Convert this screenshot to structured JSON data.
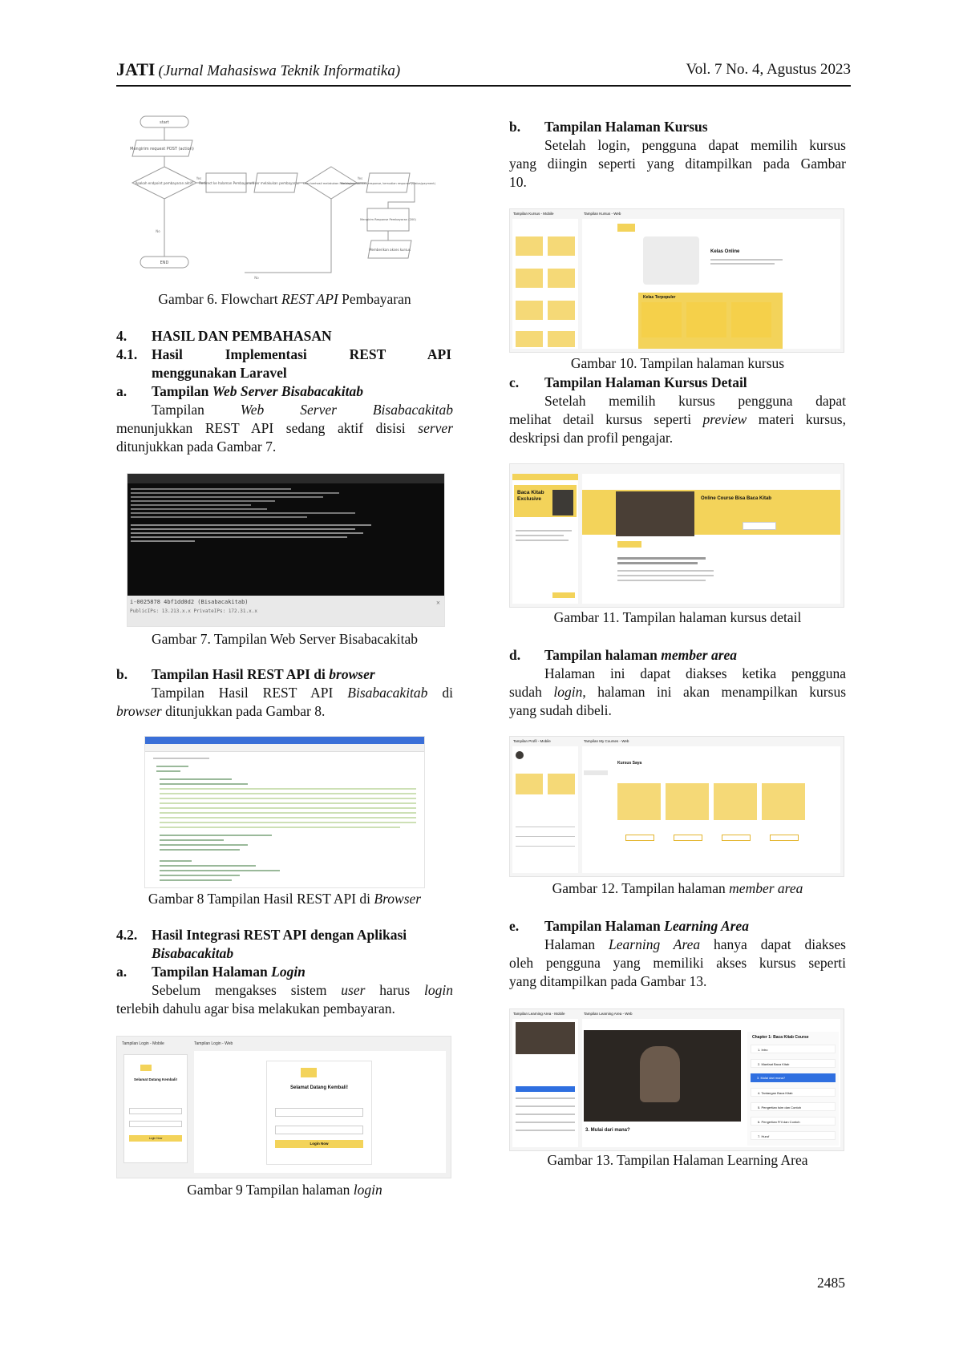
{
  "header": {
    "journal": "JATI",
    "journal_full": "(Jurnal Mahasiswa Teknik Informatika)",
    "volume": "Vol. 7 No. 4, Agustus 2023"
  },
  "left": {
    "fig6_caption_pre": "Gambar 6. Flowchart ",
    "fig6_caption_em": "REST API",
    "fig6_caption_post": " Pembayaran",
    "flowchart": {
      "start": "start",
      "n1": "Mengirim request POST (action)",
      "n2": "Apakah endpoint pembayaran aktif?",
      "n3": "Redirect ke halaman Pembayaran",
      "n4": "User melakukan pembayaran",
      "n5": "User berhasil melakukan Pembayaran?",
      "n6": "Melakukan validasi response, kemudian response (status/payment)",
      "n7": "Mengirim Response Pembayaran (200)",
      "n8": "Memberikan akses kursus",
      "yes": "Yes",
      "no": "No",
      "end": "END"
    },
    "sec4_num": "4.",
    "sec4_title": "HASIL DAN PEMBAHASAN",
    "sec41_num": "4.1.",
    "sec41_title_l1": "Hasil Implementasi REST API",
    "sec41_title_l2": "menggunakan Laravel",
    "a_label": "a.",
    "a_title_pre": "Tampilan ",
    "a_title_em": "Web Server Bisabacakitab",
    "a_p_l1_pre": "Tampilan ",
    "a_p_l1_em": "Web Server Bisabacakitab",
    "a_p_l2_pre": "menunjukkan REST API sedang aktif disisi ",
    "a_p_l2_em": "server",
    "a_p_l3": "ditunjukkan pada Gambar 7.",
    "terminal_footer_l1": "i-0025878 4bf1dd0d2 (Bisabacakitab)",
    "terminal_footer_l2": "PublicIPs: 13.213.x.x  PrivateIPs: 172.31.x.x",
    "fig7_caption": "Gambar 7. Tampilan Web Server Bisabacakitab",
    "b_label": "b.",
    "b_title_pre": "Tampilan Hasil REST API di ",
    "b_title_em": "browser",
    "b_p_l1_pre": "Tampilan Hasil REST API ",
    "b_p_l1_em": "Bisabacakitab",
    "b_p_l1_post": " di",
    "b_p_l2_em": "browser",
    "b_p_l2_post": " ditunjukkan pada Gambar 8.",
    "fig8_caption_pre": "Gambar 8 Tampilan Hasil REST API di ",
    "fig8_caption_em": "Browser",
    "sec42_num": "4.2.",
    "sec42_title_l1": "Hasil Integrasi REST API dengan Aplikasi",
    "sec42_title_l2": "Bisabacakitab",
    "a2_label": "a.",
    "a2_title_pre": "Tampilan Halaman ",
    "a2_title_em": "Login",
    "a2_p_l1_pre": "Sebelum mengakses sistem ",
    "a2_p_l1_em": "user",
    "a2_p_l1_mid": " harus ",
    "a2_p_l1_em2": "login",
    "a2_p_l2": "terlebih dahulu agar bisa melakukan pembayaran.",
    "login_mobile_label": "Tampilan Login - Mobile",
    "login_web_label": "Tampilan Login - Web",
    "login_welcome": "Selamat Datang Kembali!",
    "login_button": "Login Now",
    "fig9_caption_pre": "Gambar 9 Tampilan halaman ",
    "fig9_caption_em": "login"
  },
  "right": {
    "b_label": "b.",
    "b_title": "Tampilan Halaman Kursus",
    "b_p_l1": "Setelah login, pengguna dapat memilih kursus",
    "b_p_l2": "yang diingin seperti yang ditampilkan pada Gambar",
    "b_p_l3": "10.",
    "kursus_mobile_label": "Tampilan Kursus - Mobile",
    "kursus_web_label": "Tampilan Kursus - Web",
    "kelas_online": "Kelas Online",
    "kelas_terpopuler": "Kelas Terpopuler",
    "fig10_caption": "Gambar 10. Tampilan halaman kursus",
    "c_label": "c.",
    "c_title": "Tampilan Halaman Kursus Detail",
    "c_p_l1": "Setelah memilih kursus pengguna dapat",
    "c_p_l2_pre": "melihat detail kursus seperti ",
    "c_p_l2_em": "preview",
    "c_p_l2_post": " materi kursus,",
    "c_p_l3": "deskripsi dan profil pengajar.",
    "detail_card_title": "Baca Kitab Exclusive",
    "detail_course_title": "Online Course Bisa Baca Kitab",
    "fig11_caption": "Gambar 11. Tampilan halaman kursus detail",
    "d_label": "d.",
    "d_title_pre": "Tampilan halaman ",
    "d_title_em": "member area",
    "d_p_l1": "Halaman ini dapat diakses ketika pengguna",
    "d_p_l2_pre": "sudah ",
    "d_p_l2_em": "login",
    "d_p_l2_post": ", halaman ini akan menampilkan kursus",
    "d_p_l3": "yang sudah dibeli.",
    "member_mobile_label": "Tampilan Profil - Mobile",
    "member_web_label": "Tampilan My Courses - Web",
    "kursus_saya": "Kursus Saya",
    "fig12_caption_pre": "Gambar 12. Tampilan halaman ",
    "fig12_caption_em": "member area",
    "e_label": "e.",
    "e_title_pre": "Tampilan Halaman ",
    "e_title_em": "Learning Area",
    "e_p_l1_pre": "Halaman ",
    "e_p_l1_em": "Learning Area",
    "e_p_l1_post": " hanya dapat diakses",
    "e_p_l2": "oleh pengguna yang memiliki akses kursus seperti",
    "e_p_l3": "yang ditampilkan pada Gambar 13.",
    "learning_mobile_label": "Tampilan Learning Area - Mobile",
    "learning_web_label": "Tampilan Learning Area - Web",
    "chapter_title": "Chapter 1: Baca Kitab Course",
    "video_subtitle": "3. Mulai dari mana?",
    "lessons": [
      "1. Intro",
      "2. Manfaat Baca Kitab",
      "3. Mulai dari mana?",
      "4. Tantangan Baca Kitab",
      "5. Pengertian Isim dan Contoh",
      "6. Pengertian Fi'il dan Contoh",
      "7. Huruf"
    ],
    "fig13_caption": "Gambar 13. Tampilan Halaman Learning Area"
  },
  "page_number": "2485",
  "colors": {
    "accent_yellow": "#f3d35a",
    "terminal_bg": "#0c0c0c",
    "browser_blue": "#3a6fd8",
    "video_dark": "#2b2622"
  }
}
